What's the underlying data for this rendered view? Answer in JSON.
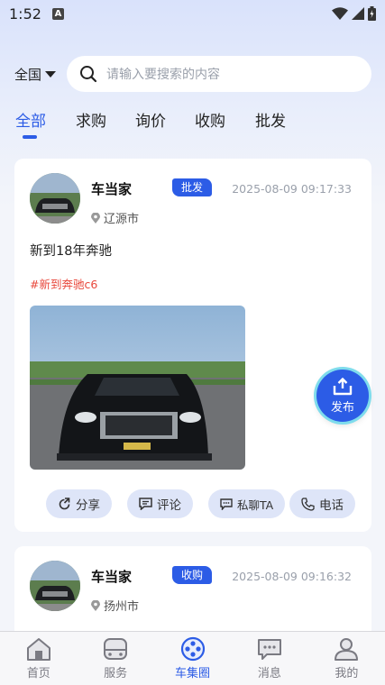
{
  "status_bar": {
    "time": "1:52",
    "a_indicator": "A",
    "icons": [
      "wifi-icon",
      "signal-icon",
      "battery-icon"
    ]
  },
  "header": {
    "region": "全国",
    "search_placeholder": "请输入要搜索的内容"
  },
  "tabs": [
    {
      "label": "全部",
      "active": true
    },
    {
      "label": "求购",
      "active": false
    },
    {
      "label": "询价",
      "active": false
    },
    {
      "label": "收购",
      "active": false
    },
    {
      "label": "批发",
      "active": false
    }
  ],
  "posts": [
    {
      "user": "车当家",
      "badge": "批发",
      "date": "2025-08-09 09:17:33",
      "location": "辽源市",
      "text": "新到18年奔驰",
      "tag": "#新到奔驰c6",
      "actions": {
        "share": "分享",
        "comment": "评论",
        "message": "私聊TA",
        "phone": "电话"
      }
    },
    {
      "user": "车当家",
      "badge": "收购",
      "date": "2025-08-09 09:16:32",
      "location": "扬州市"
    }
  ],
  "fab": {
    "label": "发布"
  },
  "bottom_nav": [
    {
      "label": "首页",
      "icon": "home-icon",
      "active": false
    },
    {
      "label": "服务",
      "icon": "car-service-icon",
      "active": false
    },
    {
      "label": "车集圈",
      "icon": "film-reel-icon",
      "active": true
    },
    {
      "label": "消息",
      "icon": "chat-bubble-icon",
      "active": false
    },
    {
      "label": "我的",
      "icon": "user-icon",
      "active": false
    }
  ],
  "colors": {
    "accent": "#2c5ce6",
    "tag": "#e8473b",
    "action_bg": "#dee5f8"
  }
}
